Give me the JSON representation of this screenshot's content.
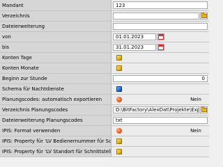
{
  "rows": [
    {
      "label": "Mandant",
      "value": "123"
    },
    {
      "label": "Verzeichnis",
      "value": ""
    },
    {
      "label": "Dateierweiterung",
      "value": ""
    },
    {
      "label": "von",
      "value": "01.01.2023"
    },
    {
      "label": "bis",
      "value": "31.01.2023"
    },
    {
      "label": "Konten Tage",
      "value": ""
    },
    {
      "label": "Konten Monate",
      "value": ""
    },
    {
      "label": "Beginn zur Stunde",
      "value": "0"
    },
    {
      "label": "Schema für Nachtdienste",
      "value": ""
    },
    {
      "label": "Planungscodes: automatisch exportieren",
      "value": "Nein"
    },
    {
      "label": "Verzeichnis Planungscodes",
      "value": "D:\\BitFactory\\AlexDat\\Projekte\\Exporte_"
    },
    {
      "label": "Dateierweiterung Planungscodes",
      "value": "txt"
    },
    {
      "label": "IPIS: Format verwenden",
      "value": "Nein"
    },
    {
      "label": "IPIS: Property für 'LV Bedienernummer für Schnittstelle'",
      "value": ""
    },
    {
      "label": "IPIS: Property für 'LV Standort für Schnittstelle'",
      "value": ""
    }
  ],
  "icons": {
    "cube_yellow": "yellow-cube-icon",
    "cube_blue": "blue-cube-icon",
    "toggle_off": "red-dot-icon",
    "calendar": "calendar-icon",
    "folder": "folder-browse-icon"
  }
}
